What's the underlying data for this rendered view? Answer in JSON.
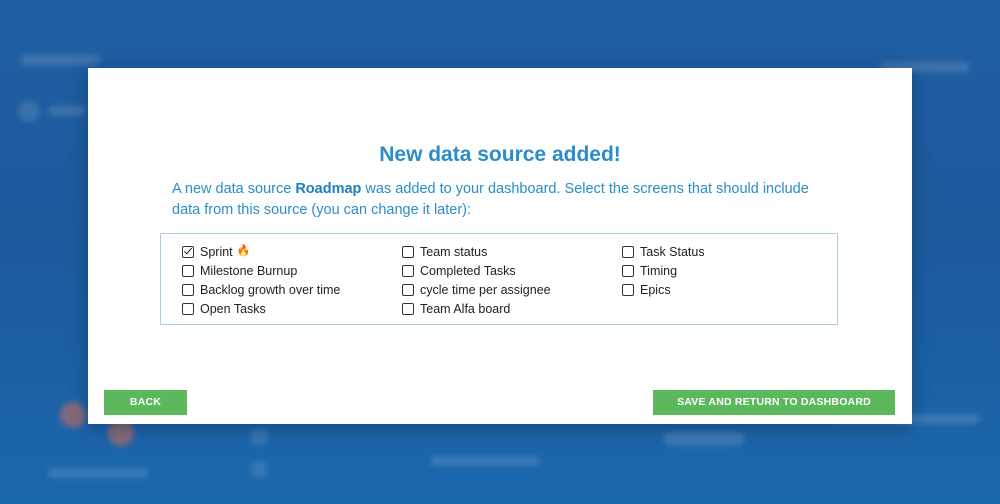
{
  "modal": {
    "title": "New data source added!",
    "description_prefix": "A new data source ",
    "source_name": "Roadmap",
    "description_suffix": " was added to your dashboard. Select the screens that should include data from this source (you can change it later):"
  },
  "screens": {
    "columns": [
      [
        {
          "label": "Sprint",
          "checked": true,
          "icon": "fire-icon"
        },
        {
          "label": "Milestone Burnup",
          "checked": false
        },
        {
          "label": "Backlog growth over time",
          "checked": false
        },
        {
          "label": "Open Tasks",
          "checked": false
        }
      ],
      [
        {
          "label": "Team status",
          "checked": false
        },
        {
          "label": "Completed Tasks",
          "checked": false
        },
        {
          "label": "cycle time per assignee",
          "checked": false
        },
        {
          "label": "Team Alfa board",
          "checked": false
        }
      ],
      [
        {
          "label": "Task Status",
          "checked": false
        },
        {
          "label": "Timing",
          "checked": false
        },
        {
          "label": "Epics",
          "checked": false
        }
      ]
    ]
  },
  "buttons": {
    "back_label": "BACK",
    "save_label": "SAVE AND RETURN TO DASHBOARD"
  },
  "colors": {
    "accent": "#2a8dc9",
    "button": "#5cb85c",
    "backdrop": "#1f5fa3",
    "fire": "#f07a2a"
  }
}
